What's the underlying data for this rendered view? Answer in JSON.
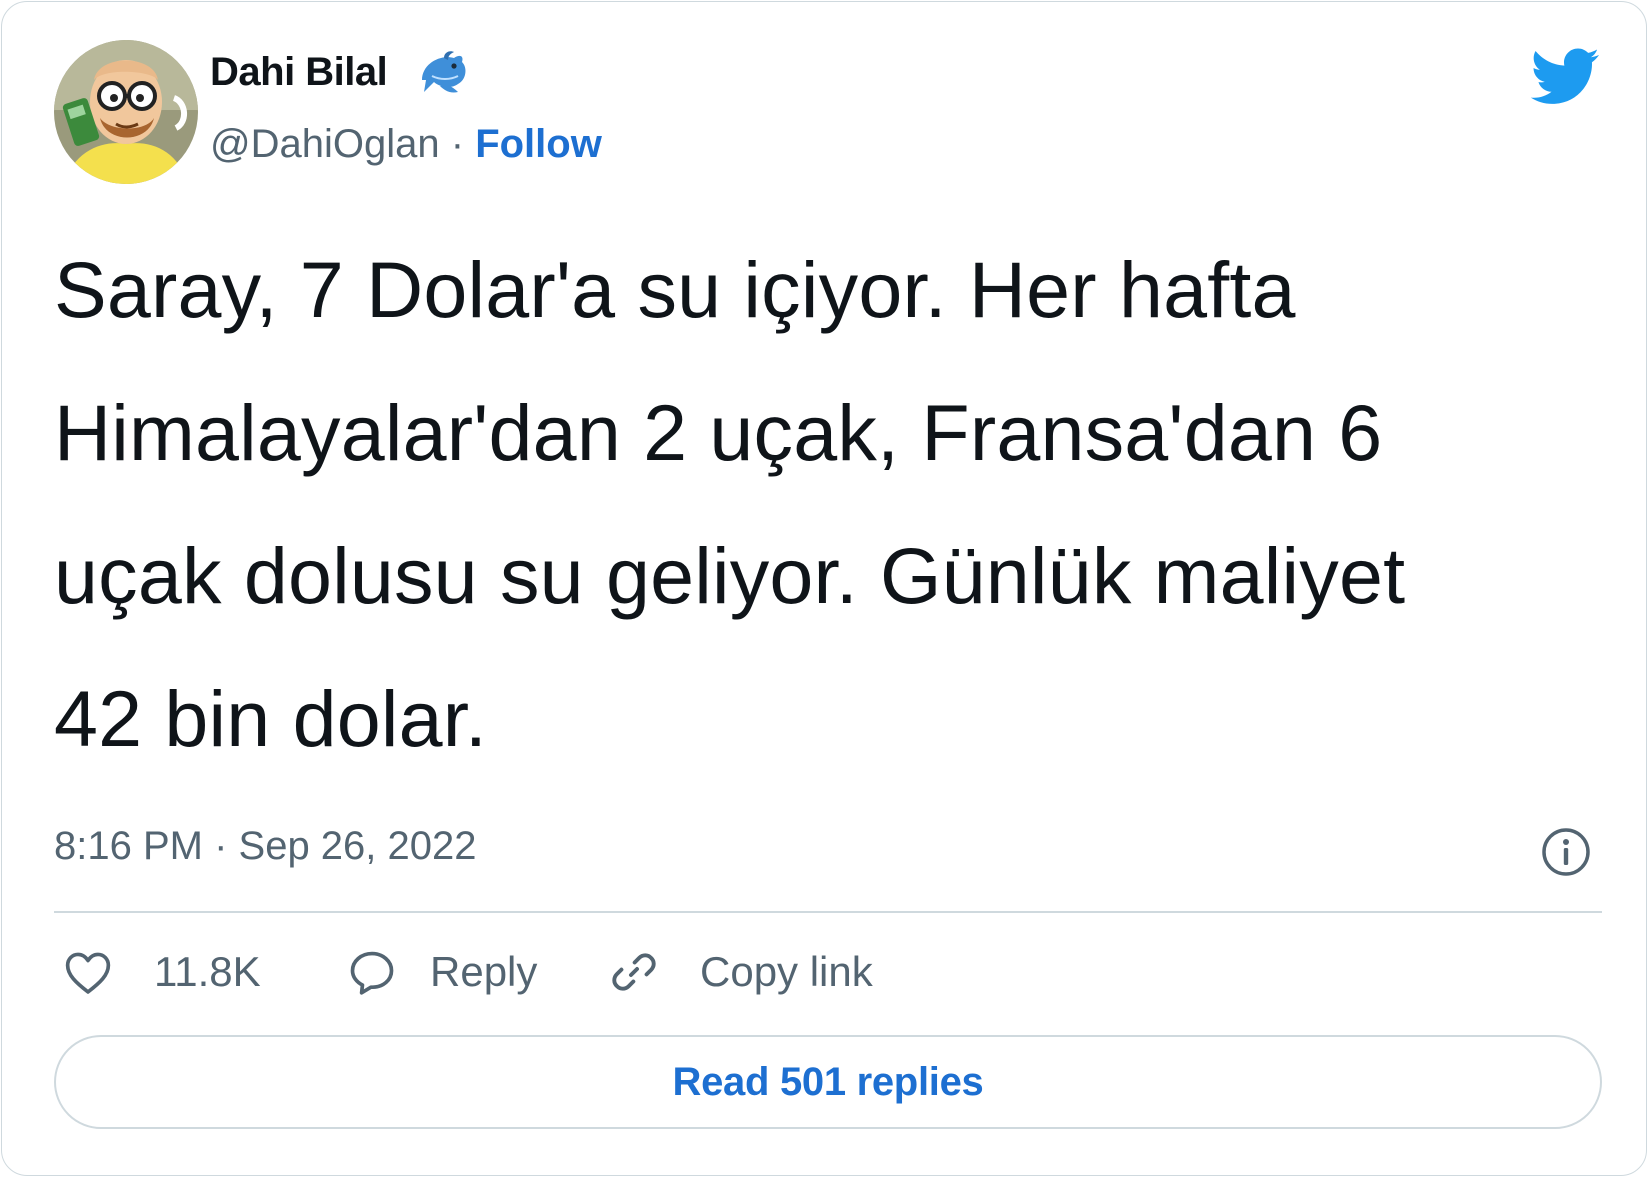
{
  "author": {
    "name": "Dahi Bilal",
    "badge_icon": "dolphin-icon",
    "handle": "@DahiOglan",
    "separator": "·",
    "follow_label": "Follow",
    "avatar_icon": "cartoon-avatar"
  },
  "platform_icon": "twitter-bird-icon",
  "tweet": {
    "lines": [
      "Saray, 7 Dolar'a su içiyor. Her hafta",
      "Himalayalar'dan 2 uçak, Fransa'dan 6",
      "uçak dolusu su geliyor. Günlük maliyet",
      "42 bin dolar."
    ],
    "timestamp": "8:16 PM · Sep 26, 2022",
    "info_icon": "info-icon"
  },
  "actions": {
    "like": {
      "icon": "heart-icon",
      "label": "11.8K"
    },
    "reply": {
      "icon": "speech-bubble-icon",
      "label": "Reply"
    },
    "copy_link": {
      "icon": "link-icon",
      "label": "Copy link"
    }
  },
  "read_replies_label": "Read 501 replies",
  "colors": {
    "link_blue": "#1d6fd1",
    "twitter_blue": "#1d9bf0",
    "text_primary": "#0f1419",
    "text_secondary": "#536471",
    "border": "#cfd9de"
  }
}
